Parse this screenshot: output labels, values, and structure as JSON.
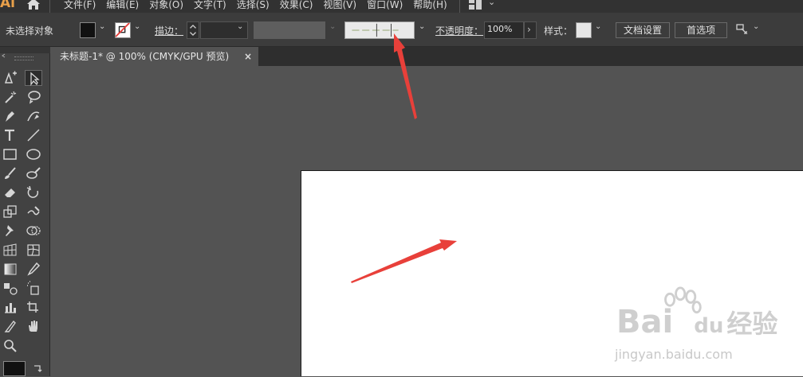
{
  "app": {
    "logo": "Ai"
  },
  "menubar": {
    "menus": [
      "文件(F)",
      "编辑(E)",
      "对象(O)",
      "文字(T)",
      "选择(S)",
      "效果(C)",
      "视图(V)",
      "窗口(W)",
      "帮助(H)"
    ]
  },
  "controlbar": {
    "selection_status": "未选择对象",
    "stroke_label": "描边：",
    "opacity_label": "不透明度：",
    "opacity_value": "100%",
    "style_label": "样式：",
    "doc_setup_button": "文档设置",
    "preferences_button": "首选项",
    "fill_color": "#111111",
    "stroke_color": "#ffffff",
    "no_stroke_slash_color": "#e53935"
  },
  "document": {
    "tab_title": "未标题-1* @ 100% (CMYK/GPU 预览)",
    "tab_close": "×"
  },
  "toolbar": {
    "tools": [
      "pen-plus-icon",
      "direct-selection-icon",
      "magic-wand-icon",
      "lasso-icon",
      "pen-icon",
      "curvature-icon",
      "type-icon",
      "line-icon",
      "rectangle-icon",
      "ellipse-icon",
      "paintbrush-icon",
      "blob-brush-icon",
      "eraser-icon",
      "rotate-icon",
      "scale-icon",
      "warp-icon",
      "puppet-pin-icon",
      "shape-builder-icon",
      "perspective-grid-icon",
      "mesh-icon",
      "gradient-icon",
      "eyedropper-icon",
      "blend-icon",
      "symbol-sprayer-icon",
      "column-graph-icon",
      "artboard-icon",
      "slice-icon",
      "hand-icon",
      "zoom-icon"
    ]
  },
  "watermark": {
    "brand_latin": "Bai",
    "brand_mid": "du",
    "brand_cn": "经验",
    "url": "jingyan.baidu.com"
  },
  "annotations": {
    "arrow_color": "#e8403a"
  }
}
